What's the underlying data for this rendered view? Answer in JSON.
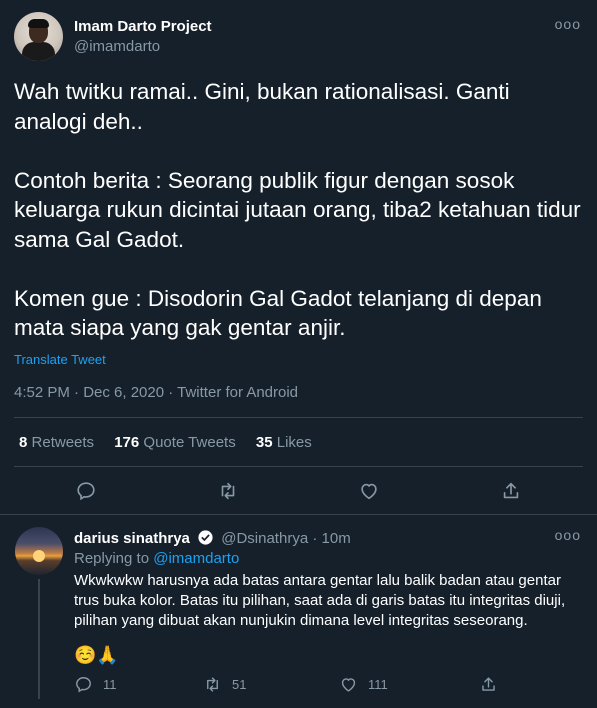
{
  "tweet": {
    "author_name": "Imam Darto Project",
    "author_handle": "@imamdarto",
    "text": "Wah twitku ramai.. Gini, bukan rationalisasi. Ganti analogi deh..\n\nContoh berita : Seorang publik figur dengan sosok keluarga rukun dicintai jutaan orang, tiba2 ketahuan tidur sama Gal Gadot.\n\nKomen gue : Disodorin Gal Gadot telanjang di depan mata siapa yang gak gentar anjir.",
    "translate_label": "Translate Tweet",
    "meta": "4:52 PM · Dec 6, 2020 · Twitter for Android",
    "more_label": "ooo"
  },
  "stats": {
    "retweets_count": "8",
    "retweets_label": "Retweets",
    "quotes_count": "176",
    "quotes_label": "Quote Tweets",
    "likes_count": "35",
    "likes_label": "Likes"
  },
  "reply": {
    "name": "darius sinathrya",
    "handle": "@Dsinathrya",
    "time": "10m",
    "replying_prefix": "Replying to",
    "replying_to": "@imamdarto",
    "text": "Wkwkwkw harusnya ada batas antara gentar lalu balik badan atau gentar trus buka kolor. Batas itu pilihan, saat ada di garis batas itu integritas diuji, pilihan yang dibuat akan nunjukin dimana level integritas seseorang.",
    "emoji": "☺️🙏",
    "reply_count": "11",
    "retweet_count": "51",
    "like_count": "111",
    "more_label": "ooo"
  },
  "colors": {
    "background": "#15202b",
    "secondary_text": "#8899a6",
    "accent": "#1da1f2",
    "divider": "#38444d"
  }
}
